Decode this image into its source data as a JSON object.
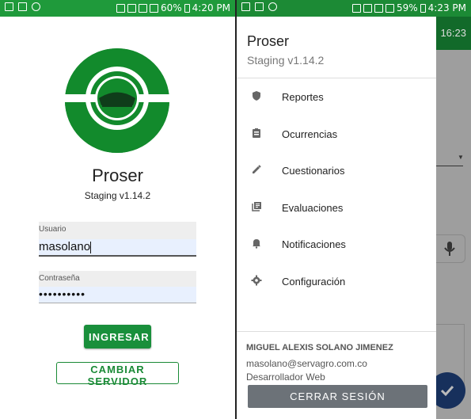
{
  "left_status": {
    "left_icons": "",
    "battery": "60%",
    "time": "4:20 PM"
  },
  "right_status": {
    "battery": "59%",
    "time": "4:23 PM"
  },
  "login": {
    "title": "Proser",
    "version": "Staging v1.14.2",
    "username_label": "Usuario",
    "username_value": "masolano",
    "password_label": "Contraseña",
    "password_value": "••••••••••",
    "login_button": "INGRESAR",
    "change_server_button": "CAMBIAR SERVIDOR"
  },
  "background_app": {
    "clock": "16:23"
  },
  "drawer": {
    "title": "Proser",
    "version": "Staging v1.14.2",
    "items": [
      {
        "label": "Reportes",
        "icon": "shield-icon"
      },
      {
        "label": "Ocurrencias",
        "icon": "clipboard-icon"
      },
      {
        "label": "Cuestionarios",
        "icon": "pencil-icon"
      },
      {
        "label": "Evaluaciones",
        "icon": "library-icon"
      },
      {
        "label": "Notificaciones",
        "icon": "bell-icon"
      },
      {
        "label": "Configuración",
        "icon": "gear-icon"
      }
    ],
    "user": {
      "name": "MIGUEL ALEXIS SOLANO JIMENEZ",
      "email": "masolano@servagro.com.co",
      "role": "Desarrollador Web"
    },
    "logout_button": "CERRAR SESIÓN"
  },
  "colors": {
    "primary_green": "#198f3b",
    "status_green": "#1f9a3b",
    "drawer_button": "#6c7278",
    "fab": "#17305c"
  }
}
